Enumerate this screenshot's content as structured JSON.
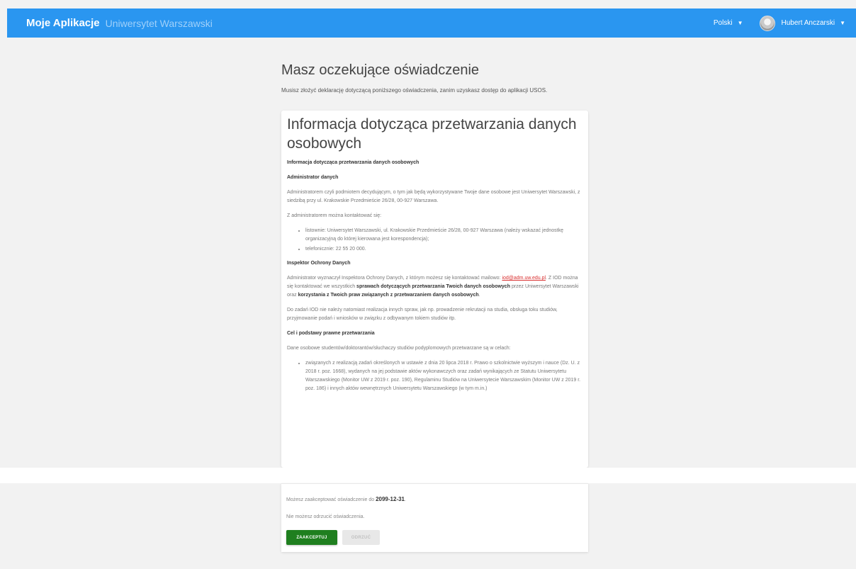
{
  "header": {
    "app_name": "Moje Aplikacje",
    "institution": "Uniwersytet Warszawski",
    "language": "Polski",
    "user_name": "Hubert Anczarski",
    "colors": {
      "topbar": "#2a96f0",
      "accept_button": "#1f7f1f"
    }
  },
  "page": {
    "title": "Masz oczekujące oświadczenie",
    "intro": "Musisz złożyć deklarację dotyczącą poniższego oświadczenia, zanim uzyskasz dostęp do aplikacji USOS."
  },
  "statement": {
    "title": "Informacja dotycząca przetwarzania danych osobowych",
    "heading_main": "Informacja dotycząca przetwarzania danych osobowych",
    "heading_admin": "Administrator danych",
    "admin_text": "Administratorem czyli podmiotem decydującym, o tym jak będą wykorzystywane Twoje dane osobowe jest Uniwersytet Warszawski, z siedzibą przy ul. Krakowskie Przedmieście 26/28, 00-927 Warszawa.",
    "contact_intro": "Z administratorem można kontaktować się:",
    "contact_items": [
      "listownie: Uniwersytet Warszawski, ul. Krakowskie Przedmieście 26/28, 00-927 Warszawa (należy wskazać jednostkę organizacyjną do której kierowana jest korespondencja);",
      "telefonicznie: 22 55 20 000."
    ],
    "heading_iod": "Inspektor Ochrony Danych",
    "iod_text_1": "Administrator wyznaczył Inspektora Ochrony Danych, z którym możesz się kontaktować mailowo:",
    "iod_email": "iod@adm.uw.edu.pl",
    "iod_text_2": ". Z IOD można się kontaktować we wszystkich",
    "iod_bold_1": "sprawach dotyczących przetwarzania Twoich danych osobowych",
    "iod_text_3": "przez Uniwersytet Warszawski oraz",
    "iod_bold_2": "korzystania z Twoich praw związanych z przetwarzaniem danych osobowych",
    "iod_text_4": ".",
    "iod_tasks": "Do zadań IOD nie należy natomiast realizacja innych spraw, jak np. prowadzenie rekrutacji na studia, obsługa toku studiów, przyjmowanie podań i wniosków w związku z odbywanym tokiem studiów itp.",
    "heading_purpose": "Cel i podstawy prawne przetwarzania",
    "purpose_intro": "Dane osobowe studentów/doktorantów/słuchaczy studiów podyplomowych przetwarzane są w celach:",
    "purpose_items": [
      "związanych z realizacją zadań określonych w ustawie z dnia 20 lipca 2018 r. Prawo o szkolnictwie wyższym i nauce (Dz. U. z 2018 r. poz. 1668), wydanych na jej podstawie aktów wykonawczych oraz zadań wynikających ze Statutu Uniwersytetu Warszawskiego (Monitor UW z 2019 r. poz. 190), Regulaminu Studiów na Uniwersytecie Warszawskim (Monitor UW z 2019 r. poz. 186) i innych aktów wewnętrznych Uniwersytetu Warszawskiego (w tym m.in.)"
    ]
  },
  "footer": {
    "accept_until_text": "Możesz zaakceptować oświadczenie do",
    "accept_until_date": "2099-12-31",
    "accept_until_end": ".",
    "cannot_reject": "Nie możesz odrzucić oświadczenia.",
    "accept_label": "ZAAKCEPTUJ",
    "reject_label": "ODRZUĆ"
  }
}
